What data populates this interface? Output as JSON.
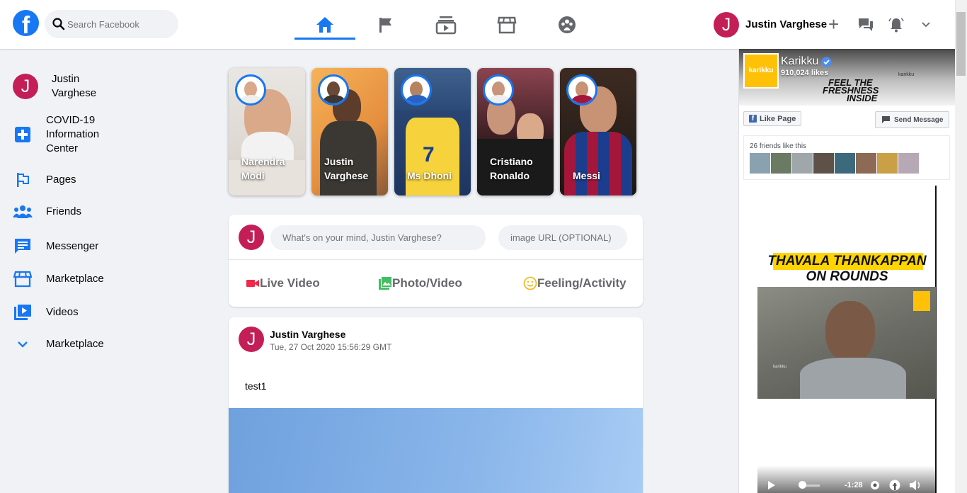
{
  "header": {
    "logo": "f",
    "search_placeholder": "Search Facebook",
    "nav": [
      "home-icon",
      "pages-flag-icon",
      "watch-icon",
      "marketplace-icon",
      "groups-icon"
    ],
    "user_initial": "J",
    "user_name": "Justin Varghese",
    "plus": "+"
  },
  "sidebar": {
    "user_initial": "J",
    "user_name": "Justin Varghese",
    "items": [
      {
        "label": "COVID-19 Information Center",
        "icon": "covid-plus-icon"
      },
      {
        "label": "Pages",
        "icon": "pages-flag-icon"
      },
      {
        "label": "Friends",
        "icon": "friends-icon"
      },
      {
        "label": "Messenger",
        "icon": "messenger-icon"
      },
      {
        "label": "Marketplace",
        "icon": "marketplace-icon"
      },
      {
        "label": "Videos",
        "icon": "videos-icon"
      },
      {
        "label": "Marketplace",
        "icon": "chevron-down-icon"
      }
    ]
  },
  "stories": [
    {
      "name": "Narendra Modi"
    },
    {
      "name": "Justin Varghese"
    },
    {
      "name": "Ms Dhoni"
    },
    {
      "name": "Cristiano Ronaldo"
    },
    {
      "name": "Messi"
    }
  ],
  "composer": {
    "user_initial": "J",
    "post_placeholder": "What's on your mind, Justin Varghese?",
    "url_placeholder": "image URL (OPTIONAL)",
    "actions": [
      "Live Video",
      "Photo/Video",
      "Feeling/Activity"
    ]
  },
  "post": {
    "user_initial": "J",
    "author": "Justin Varghese",
    "timestamp": "Tue, 27 Oct 2020 15:56:29 GMT",
    "text": "test1"
  },
  "page_plugin": {
    "page_name": "Karikku",
    "likes": "910,024 likes",
    "logo_text": "karikku",
    "cover_text_1": "FEEL THE",
    "cover_text_2": "FRESHNESS",
    "cover_text_3": "INSIDE",
    "cover_brand": "karikku",
    "like_button": "Like Page",
    "message_button": "Send Message",
    "friends_like": "26 friends like this",
    "video_title_1": "THAVALA THANKAPPAN",
    "video_title_2": "ON ROUNDS",
    "video_watermark": "karikku",
    "video_time": "-1:28"
  },
  "colors": {
    "brand": "#1877f2",
    "avatar": "#c41e56",
    "live": "#f02849",
    "photo": "#45bd62",
    "feeling": "#f7b928"
  }
}
